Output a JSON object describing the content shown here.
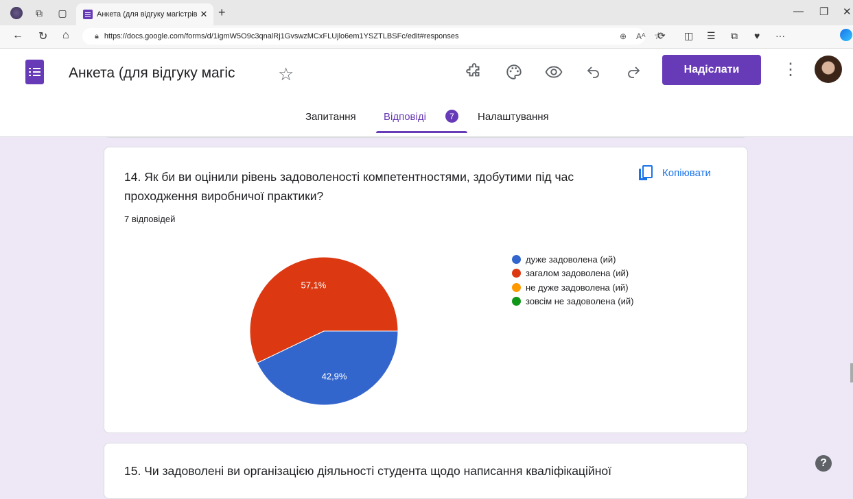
{
  "browser": {
    "tab_title": "Анкета (для відгуку магістрів пр",
    "url": "https://docs.google.com/forms/d/1igmW5O9c3qnalRj1GvswzMCxFLUjlo6em1YSZTLBSFc/edit#responses"
  },
  "header": {
    "doc_title": "Анкета (для відгуку магіс",
    "send_label": "Надіслати"
  },
  "tabs": {
    "questions": "Запитання",
    "responses": "Відповіді",
    "responses_count": "7",
    "settings": "Налаштування"
  },
  "question14": {
    "title": "14. Як би ви оцінили рівень задоволеності компетентностями, здобутими під час проходження виробничої практики?",
    "count_label": "7 відповідей",
    "copy_label": "Копіювати"
  },
  "question15": {
    "title": "15. Чи задоволені ви організацією діяльності студента щодо написання кваліфікаційної"
  },
  "colors": {
    "accent": "#673ab7",
    "link": "#1a73e8",
    "series": [
      "#3366cc",
      "#dc3912",
      "#ff9900",
      "#109618"
    ]
  },
  "chart_data": {
    "type": "pie",
    "categories": [
      "дуже задоволена (ий)",
      "загалом задоволена (ий)",
      "не дуже задоволена (ий)",
      "зовсім не задоволена (ий)"
    ],
    "values": [
      42.9,
      57.1,
      0,
      0
    ],
    "labels": [
      "42,9%",
      "57,1%",
      "",
      ""
    ],
    "legend": "right"
  }
}
